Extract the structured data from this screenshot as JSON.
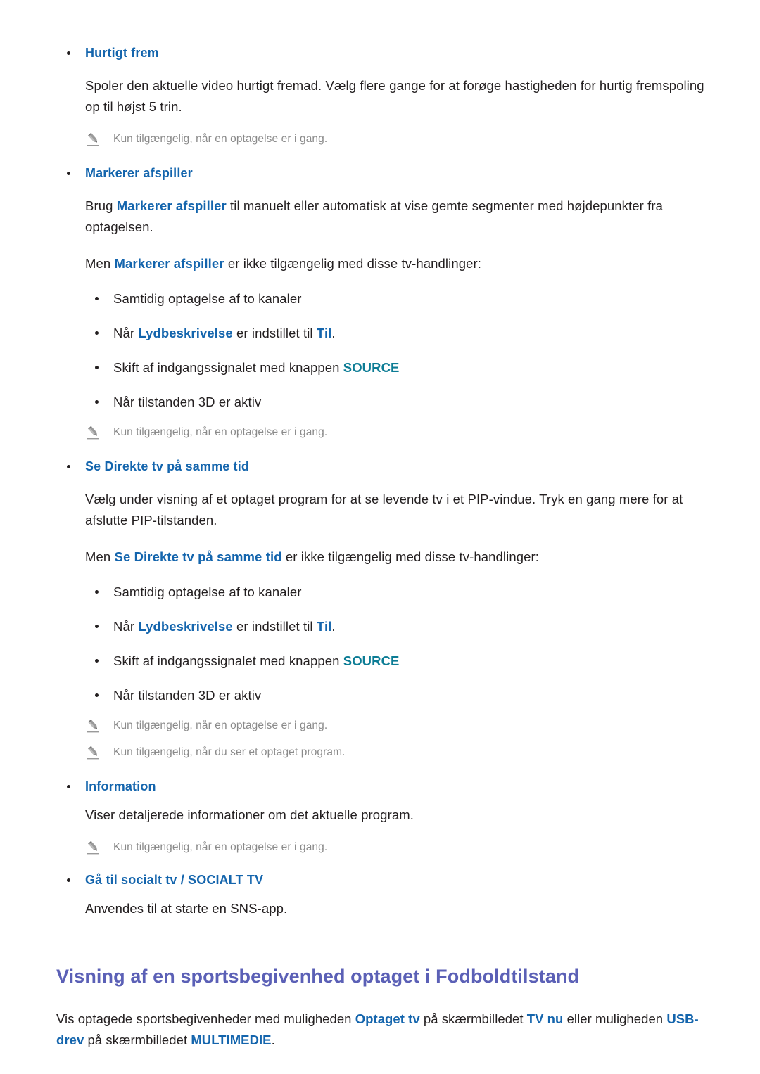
{
  "colors": {
    "text": "#231f20",
    "link_blue": "#1465ad",
    "teal": "#0c7c95",
    "heading_purple": "#5b60b6",
    "note_gray": "#8a8a8a"
  },
  "icons": {
    "note_pencil": "pencil-icon",
    "bullet": "bullet-dot"
  },
  "sections": [
    {
      "term": "Hurtigt frem",
      "paragraphs": [
        "Spoler den aktuelle video hurtigt fremad. Vælg flere gange for at forøge hastigheden for hurtig fremspoling op til højst 5 trin."
      ],
      "notes": [
        "Kun tilgængelig, når en optagelse er i gang."
      ]
    },
    {
      "term": "Markerer afspiller",
      "para_a_pre": "Brug ",
      "para_a_bold": "Markerer afspiller",
      "para_a_post": " til manuelt eller automatisk at vise gemte segmenter med højdepunkter fra optagelsen.",
      "para_b_pre": "Men ",
      "para_b_bold": "Markerer afspiller",
      "para_b_post": " er ikke tilgængelig med disse tv-handlinger:",
      "sub_items": [
        {
          "text": "Samtidig optagelse af to kanaler"
        },
        {
          "pre": "Når ",
          "bold1": "Lydbeskrivelse",
          "mid": " er indstillet til ",
          "bold2": "Til",
          "post": "."
        },
        {
          "pre": "Skift af indgangssignalet med knappen ",
          "teal": "SOURCE",
          "post": ""
        },
        {
          "text": "Når tilstanden 3D er aktiv"
        }
      ],
      "notes": [
        "Kun tilgængelig, når en optagelse er i gang."
      ]
    },
    {
      "term": "Se Direkte tv på samme tid",
      "para_a": "Vælg under visning af et optaget program for at se levende tv i et PIP-vindue. Tryk en gang mere for at afslutte PIP-tilstanden.",
      "para_b_pre": "Men ",
      "para_b_bold": "Se Direkte tv på samme tid",
      "para_b_post": " er ikke tilgængelig med disse tv-handlinger:",
      "sub_items": [
        {
          "text": "Samtidig optagelse af to kanaler"
        },
        {
          "pre": "Når ",
          "bold1": "Lydbeskrivelse",
          "mid": " er indstillet til ",
          "bold2": "Til",
          "post": "."
        },
        {
          "pre": "Skift af indgangssignalet med knappen ",
          "teal": "SOURCE",
          "post": ""
        },
        {
          "text": "Når tilstanden 3D er aktiv"
        }
      ],
      "notes": [
        "Kun tilgængelig, når en optagelse er i gang.",
        "Kun tilgængelig, når du ser et optaget program."
      ]
    },
    {
      "term": "Information",
      "paragraphs": [
        "Viser detaljerede informationer om det aktuelle program."
      ],
      "notes": [
        "Kun tilgængelig, når en optagelse er i gang."
      ]
    },
    {
      "term": "Gå til socialt tv / SOCIALT TV",
      "paragraphs": [
        "Anvendes til at starte en SNS-app."
      ],
      "notes": []
    }
  ],
  "heading": "Visning af en sportsbegivenhed optaget i Fodboldtilstand",
  "intro": {
    "p1": "Vis optagede sportsbegivenheder med muligheden ",
    "b1": "Optaget tv",
    "p2": " på skærmbilledet ",
    "b2": "TV nu",
    "p3": " eller muligheden ",
    "b3": "USB-drev",
    "p4": " på skærmbilledet ",
    "b4": "MULTIMEDIE",
    "p5": "."
  }
}
